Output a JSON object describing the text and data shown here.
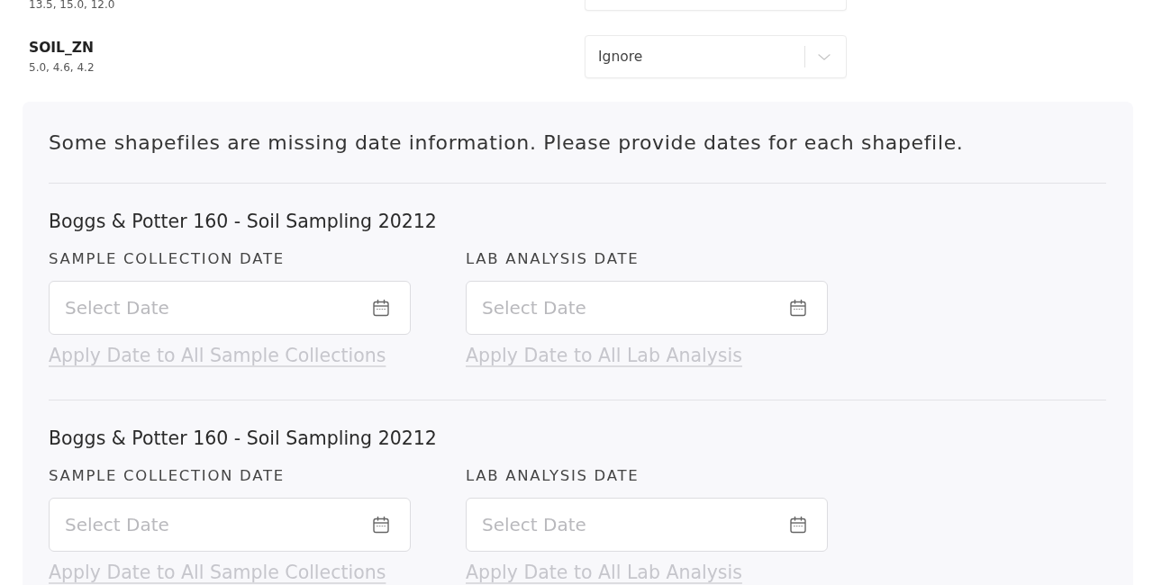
{
  "fields": [
    {
      "values": "13.5, 15.0, 12.0"
    },
    {
      "name": "SOIL_ZN",
      "values": "5.0, 4.6, 4.2",
      "selected_option": "Ignore"
    }
  ],
  "date_panel": {
    "message": "Some shapefiles are missing date information. Please provide dates for each shapefile.",
    "shapefiles": [
      {
        "title": "Boggs & Potter 160 - Soil Sampling 20212",
        "dates": [
          {
            "label": "SAMPLE COLLECTION DATE",
            "placeholder": "Select Date",
            "apply_link": {
              "text": "Apply Date to All Sample Collections",
              "disabled": true
            }
          },
          {
            "label": "LAB ANALYSIS DATE",
            "placeholder": "Select Date",
            "apply_link": {
              "text": "Apply Date to All Lab Analysis",
              "disabled": true
            }
          }
        ]
      },
      {
        "title": "Boggs & Potter 160 - Soil Sampling 20212",
        "dates": [
          {
            "label": "SAMPLE COLLECTION DATE",
            "placeholder": "Select Date",
            "apply_link": {
              "text": "Apply Date to All Sample Collections",
              "disabled": true
            }
          },
          {
            "label": "LAB ANALYSIS DATE",
            "placeholder": "Select Date",
            "apply_link": {
              "text": "Apply Date to All Lab Analysis",
              "disabled": true
            }
          }
        ]
      }
    ]
  }
}
